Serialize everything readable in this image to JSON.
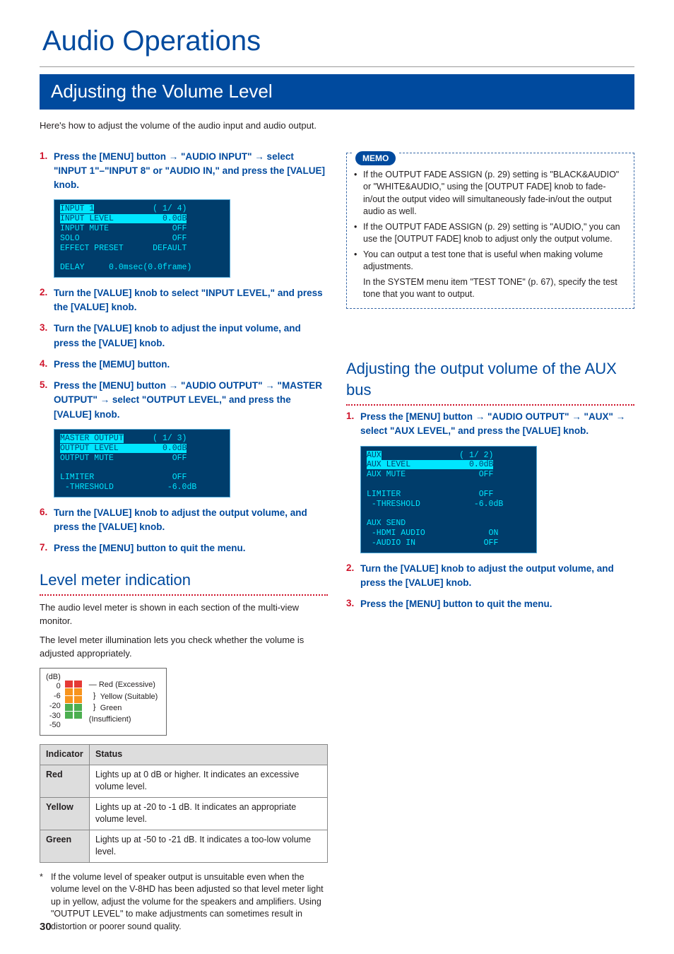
{
  "page_title": "Audio Operations",
  "section_banner": "Adjusting the Volume Level",
  "intro": "Here's how to adjust the volume of the audio input and audio output.",
  "left": {
    "steps": [
      {
        "num": "1.",
        "text": "Press the [MENU] button → \"AUDIO INPUT\" → select \"INPUT 1\"–\"INPUT 8\" or \"AUDIO IN,\" and press the [VALUE] knob."
      },
      {
        "num": "2.",
        "text": "Turn the [VALUE] knob to select \"INPUT LEVEL,\" and press the [VALUE] knob."
      },
      {
        "num": "3.",
        "text": "Turn the [VALUE] knob to adjust the input volume, and press the [VALUE] knob."
      },
      {
        "num": "4.",
        "text": "Press the [MEMU] button."
      },
      {
        "num": "5.",
        "text": "Press the [MENU] button → \"AUDIO OUTPUT\" → \"MASTER OUTPUT\" → select \"OUTPUT LEVEL,\" and press the [VALUE] knob."
      },
      {
        "num": "6.",
        "text": "Turn the [VALUE] knob to adjust the output volume, and press the [VALUE] knob."
      },
      {
        "num": "7.",
        "text": "Press the [MENU] button to quit the menu."
      }
    ],
    "lcd1": {
      "title": "INPUT 1",
      "page": "( 1/ 4)",
      "r1l": "INPUT LEVEL",
      "r1r": "0.0dB",
      "r2l": "INPUT MUTE",
      "r2r": "OFF",
      "r3l": "SOLO",
      "r3r": "OFF",
      "r4l": "EFFECT PRESET",
      "r4r": "DEFAULT",
      "r5l": "DELAY",
      "r5r": "0.0msec(0.0frame)"
    },
    "lcd2": {
      "title": "MASTER OUTPUT",
      "page": "( 1/ 3)",
      "r1l": "OUTPUT LEVEL",
      "r1r": "0.0dB",
      "r2l": "OUTPUT MUTE",
      "r2r": "OFF",
      "r3l": "LIMITER",
      "r3r": "OFF",
      "r4l": " -THRESHOLD",
      "r4r": "-6.0dB"
    },
    "subhead": "Level meter indication",
    "subtext1": "The audio level meter is shown in each section of the multi-view monitor.",
    "subtext2": "The level meter illumination lets you check whether the volume is adjusted appropriately.",
    "meter": {
      "unit": "(dB)",
      "scale": [
        "0",
        "-6",
        "-20",
        "-30",
        "-50"
      ],
      "red_label": "Red (Excessive)",
      "yellow_label": "Yellow (Suitable)",
      "green_label": "Green (Insufficient)"
    },
    "table": {
      "h1": "Indicator",
      "h2": "Status",
      "rows": [
        {
          "ind": "Red",
          "status": "Lights up at 0 dB or higher. It indicates an excessive volume level."
        },
        {
          "ind": "Yellow",
          "status": "Lights up at -20 to -1 dB. It indicates an appropriate volume level."
        },
        {
          "ind": "Green",
          "status": "Lights up at -50 to -21 dB. It indicates a too-low volume level."
        }
      ]
    },
    "footnote": "If the volume level of speaker output is unsuitable even when the volume level on the V-8HD has been adjusted so that level meter light up in yellow, adjust the volume for the speakers and amplifiers. Using \"OUTPUT LEVEL\" to make adjustments can sometimes result in distortion or poorer sound quality."
  },
  "right": {
    "memo_label": "MEMO",
    "memo": [
      "If the OUTPUT FADE ASSIGN (p. 29) setting is \"BLACK&AUDIO\" or \"WHITE&AUDIO,\" using the [OUTPUT FADE] knob to fade-in/out the output video will simultaneously fade-in/out the output audio as well.",
      "If the OUTPUT FADE ASSIGN (p. 29) setting is \"AUDIO,\" you can use the [OUTPUT FADE] knob to adjust only the output volume.",
      "You can output a test tone that is useful when making volume adjustments."
    ],
    "memo_sub": "In the SYSTEM menu item \"TEST TONE\" (p. 67), specify the test tone that you want to output.",
    "subhead": "Adjusting the output volume of the AUX bus",
    "steps": [
      {
        "num": "1.",
        "text": "Press the [MENU] button → \"AUDIO OUTPUT\" → \"AUX\" → select \"AUX LEVEL,\" and press the [VALUE] knob."
      },
      {
        "num": "2.",
        "text": "Turn the [VALUE] knob to adjust the output volume, and press the [VALUE] knob."
      },
      {
        "num": "3.",
        "text": "Press the [MENU] button to quit the menu."
      }
    ],
    "lcd3": {
      "title": "AUX",
      "page": "( 1/ 2)",
      "r1l": "AUX LEVEL",
      "r1r": "0.0dB",
      "r2l": "AUX MUTE",
      "r2r": "OFF",
      "r3l": "LIMITER",
      "r3r": "OFF",
      "r4l": " -THRESHOLD",
      "r4r": "-6.0dB",
      "r5l": "AUX SEND",
      "r5r": "",
      "r6l": " -HDMI AUDIO",
      "r6r": "ON",
      "r7l": " -AUDIO IN",
      "r7r": "OFF"
    }
  },
  "page_number": "30"
}
